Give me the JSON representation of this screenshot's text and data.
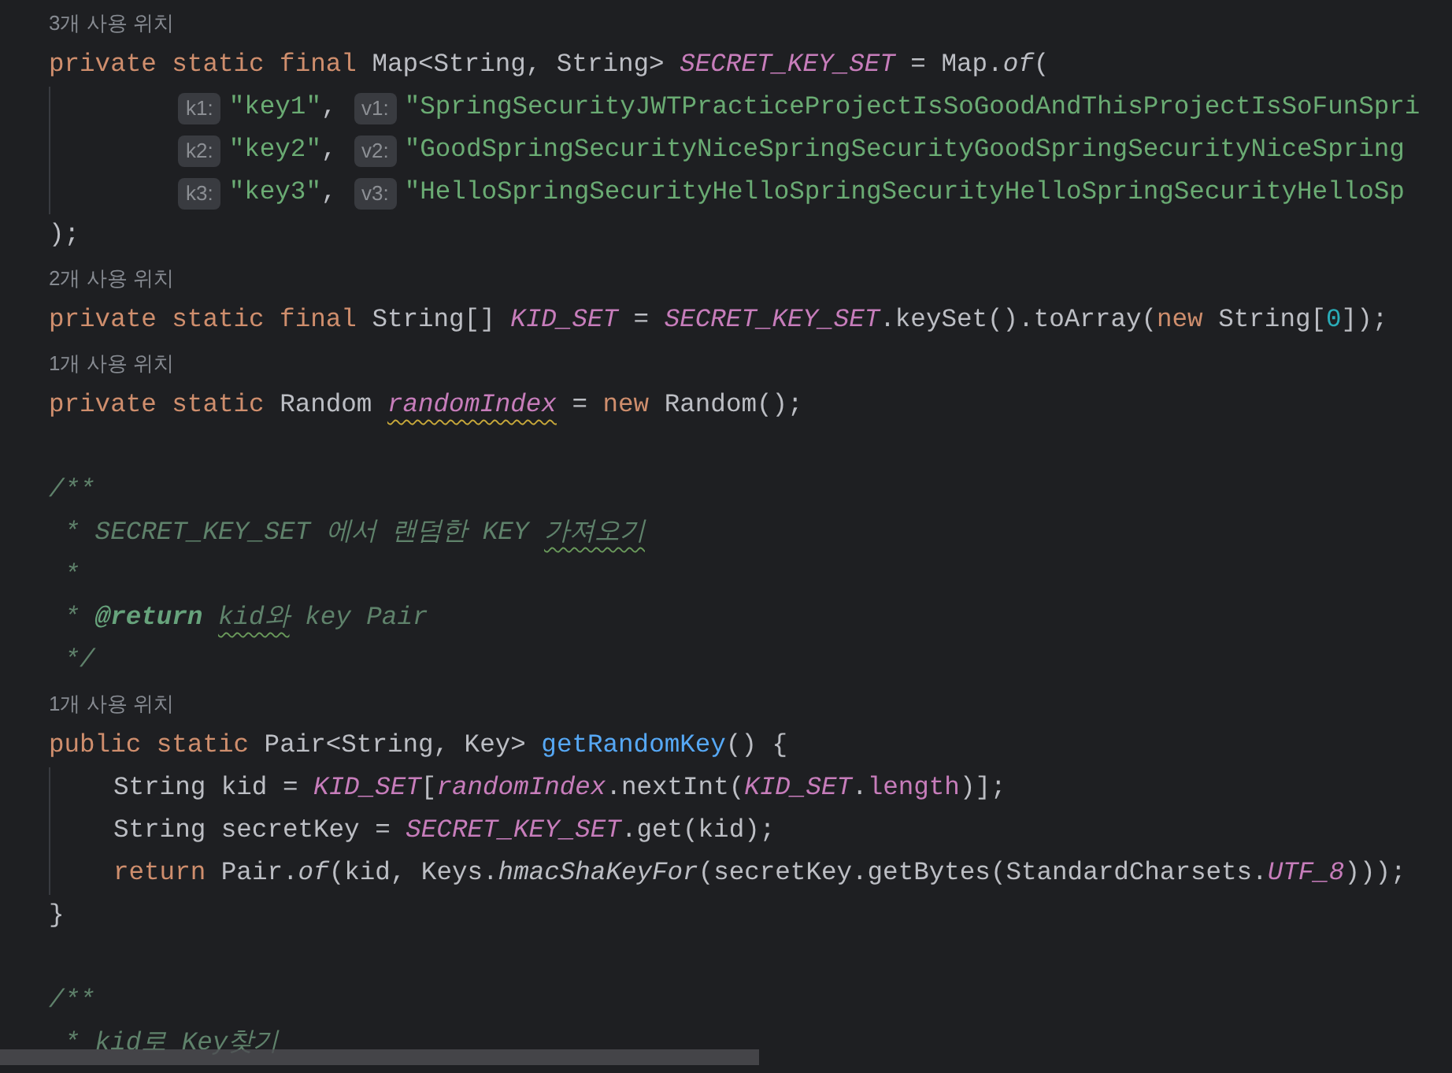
{
  "lines": [
    {
      "kind": "usage",
      "text": "3개 사용 위치"
    },
    {
      "kind": "code",
      "tokens": [
        {
          "t": "private static final ",
          "kind": "keyword"
        },
        {
          "t": "Map<String, String> ",
          "kind": "plain"
        },
        {
          "t": "SECRET_KEY_SET",
          "kind": "constant"
        },
        {
          "t": " = Map.",
          "kind": "plain"
        },
        {
          "t": "of",
          "kind": "static_call"
        },
        {
          "t": "(",
          "kind": "plain"
        }
      ]
    },
    {
      "kind": "args",
      "tokens": [
        {
          "t": "k1:",
          "kind": "hint"
        },
        {
          "t": "\"key1\"",
          "kind": "string"
        },
        {
          "t": ", ",
          "kind": "plain"
        },
        {
          "t": "v1:",
          "kind": "hint"
        },
        {
          "t": "\"SpringSecurityJWTPracticeProjectIsSoGoodAndThisProjectIsSoFunSpri",
          "kind": "string"
        }
      ]
    },
    {
      "kind": "args",
      "tokens": [
        {
          "t": "k2:",
          "kind": "hint"
        },
        {
          "t": "\"key2\"",
          "kind": "string"
        },
        {
          "t": ", ",
          "kind": "plain"
        },
        {
          "t": "v2:",
          "kind": "hint"
        },
        {
          "t": "\"GoodSpringSecurityNiceSpringSecurityGoodSpringSecurityNiceSpring",
          "kind": "string"
        }
      ]
    },
    {
      "kind": "args",
      "tokens": [
        {
          "t": "k3:",
          "kind": "hint"
        },
        {
          "t": "\"key3\"",
          "kind": "string"
        },
        {
          "t": ", ",
          "kind": "plain"
        },
        {
          "t": "v3:",
          "kind": "hint"
        },
        {
          "t": "\"HelloSpringSecurityHelloSpringSecurityHelloSpringSecurityHelloSp",
          "kind": "string"
        }
      ]
    },
    {
      "kind": "code",
      "tokens": [
        {
          "t": ");",
          "kind": "plain"
        }
      ]
    },
    {
      "kind": "usage",
      "text": "2개 사용 위치"
    },
    {
      "kind": "code",
      "tokens": [
        {
          "t": "private static final ",
          "kind": "keyword"
        },
        {
          "t": "String[] ",
          "kind": "plain"
        },
        {
          "t": "KID_SET",
          "kind": "constant"
        },
        {
          "t": " = ",
          "kind": "plain"
        },
        {
          "t": "SECRET_KEY_SET",
          "kind": "constant"
        },
        {
          "t": ".keySet().toArray(",
          "kind": "plain"
        },
        {
          "t": "new ",
          "kind": "keyword"
        },
        {
          "t": "String[",
          "kind": "plain"
        },
        {
          "t": "0",
          "kind": "number"
        },
        {
          "t": "]);",
          "kind": "plain"
        }
      ]
    },
    {
      "kind": "usage",
      "text": "1개 사용 위치"
    },
    {
      "kind": "code",
      "tokens": [
        {
          "t": "private static ",
          "kind": "keyword"
        },
        {
          "t": "Random ",
          "kind": "plain"
        },
        {
          "t": "randomIndex",
          "kind": "constant_warning"
        },
        {
          "t": " = ",
          "kind": "plain"
        },
        {
          "t": "new ",
          "kind": "keyword"
        },
        {
          "t": "Random();",
          "kind": "plain"
        }
      ]
    },
    {
      "kind": "blank"
    },
    {
      "kind": "code",
      "tokens": [
        {
          "t": "/**",
          "kind": "comment"
        }
      ]
    },
    {
      "kind": "code",
      "tokens": [
        {
          "t": " * SECRET_KEY_SET 에서 랜덤한 KEY ",
          "kind": "comment"
        },
        {
          "t": "가져오기",
          "kind": "comment_typo"
        }
      ]
    },
    {
      "kind": "code",
      "tokens": [
        {
          "t": " *",
          "kind": "comment"
        }
      ]
    },
    {
      "kind": "code",
      "tokens": [
        {
          "t": " * ",
          "kind": "comment"
        },
        {
          "t": "@return ",
          "kind": "doctag"
        },
        {
          "t": "kid와",
          "kind": "comment_typo"
        },
        {
          "t": " key Pair",
          "kind": "comment"
        }
      ]
    },
    {
      "kind": "code",
      "tokens": [
        {
          "t": " */",
          "kind": "comment"
        }
      ]
    },
    {
      "kind": "usage",
      "text": "1개 사용 위치"
    },
    {
      "kind": "code",
      "tokens": [
        {
          "t": "public static ",
          "kind": "keyword"
        },
        {
          "t": "Pair<String, Key> ",
          "kind": "plain"
        },
        {
          "t": "getRandomKey",
          "kind": "method"
        },
        {
          "t": "() {",
          "kind": "plain"
        }
      ]
    },
    {
      "kind": "body",
      "tokens": [
        {
          "t": "String kid = ",
          "kind": "plain"
        },
        {
          "t": "KID_SET",
          "kind": "constant"
        },
        {
          "t": "[",
          "kind": "plain"
        },
        {
          "t": "randomIndex",
          "kind": "constant"
        },
        {
          "t": ".nextInt(",
          "kind": "plain"
        },
        {
          "t": "KID_SET",
          "kind": "constant"
        },
        {
          "t": ".",
          "kind": "plain"
        },
        {
          "t": "length",
          "kind": "field"
        },
        {
          "t": ")];",
          "kind": "plain"
        }
      ]
    },
    {
      "kind": "body",
      "tokens": [
        {
          "t": "String secretKey = ",
          "kind": "plain"
        },
        {
          "t": "SECRET_KEY_SET",
          "kind": "constant"
        },
        {
          "t": ".get(kid);",
          "kind": "plain"
        }
      ]
    },
    {
      "kind": "body",
      "tokens": [
        {
          "t": "return ",
          "kind": "keyword"
        },
        {
          "t": "Pair.",
          "kind": "plain"
        },
        {
          "t": "of",
          "kind": "static_call"
        },
        {
          "t": "(kid, Keys.",
          "kind": "plain"
        },
        {
          "t": "hmacShaKeyFor",
          "kind": "static_call"
        },
        {
          "t": "(secretKey.getBytes(StandardCharsets.",
          "kind": "plain"
        },
        {
          "t": "UTF_8",
          "kind": "constant"
        },
        {
          "t": ")));",
          "kind": "plain"
        }
      ]
    },
    {
      "kind": "code",
      "tokens": [
        {
          "t": "}",
          "kind": "plain"
        }
      ]
    },
    {
      "kind": "blank"
    },
    {
      "kind": "code",
      "tokens": [
        {
          "t": "/**",
          "kind": "comment"
        }
      ]
    },
    {
      "kind": "code",
      "tokens": [
        {
          "t": " * kid로 Key찾기",
          "kind": "comment"
        }
      ]
    }
  ]
}
